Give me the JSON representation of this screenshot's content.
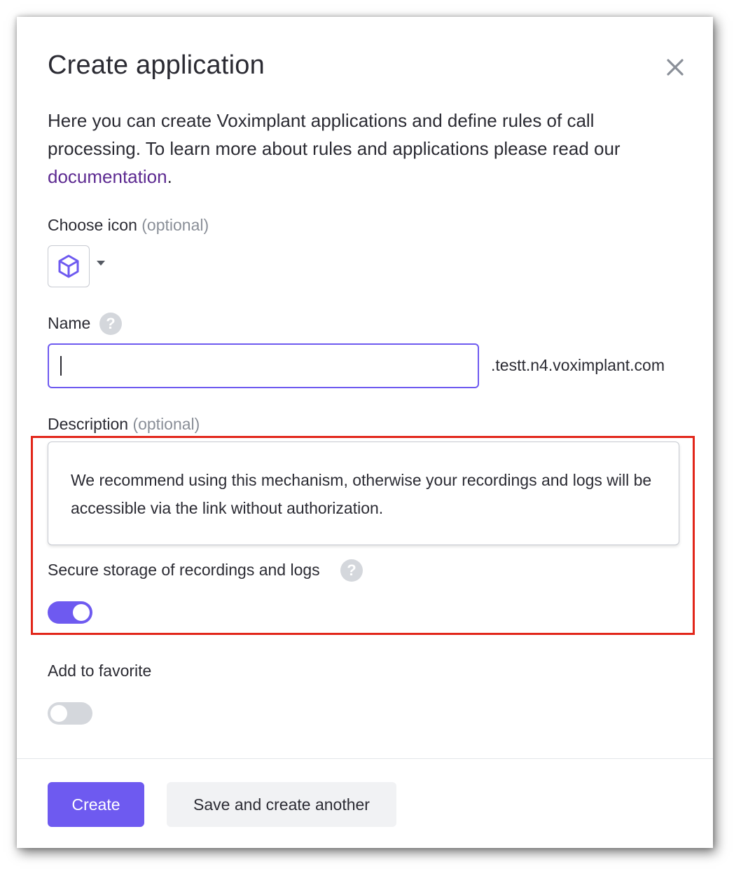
{
  "dialog": {
    "title": "Create application",
    "intro_text": "Here you can create Voximplant applications and define rules of call processing. To learn more about rules and applications please read our ",
    "intro_link": "documentation",
    "intro_end": "."
  },
  "icon_field": {
    "label": "Choose icon",
    "optional": "(optional)",
    "selected_icon": "cube-icon"
  },
  "name_field": {
    "label": "Name",
    "help": "?",
    "value": "",
    "suffix": ".testt.n4.voximplant.com"
  },
  "description_field": {
    "label": "Description",
    "optional": "(optional)",
    "value": "We recommend using this mechanism, otherwise your recordings and logs will be accessible via the link without authorization."
  },
  "secure_storage": {
    "label": "Secure storage of recordings and logs",
    "help": "?",
    "enabled": true
  },
  "favorite": {
    "label": "Add to favorite",
    "enabled": false
  },
  "footer": {
    "create_label": "Create",
    "save_another_label": "Save and create another"
  },
  "colors": {
    "accent": "#6e5af0",
    "link": "#5d2a91",
    "highlight": "#e2261a"
  }
}
